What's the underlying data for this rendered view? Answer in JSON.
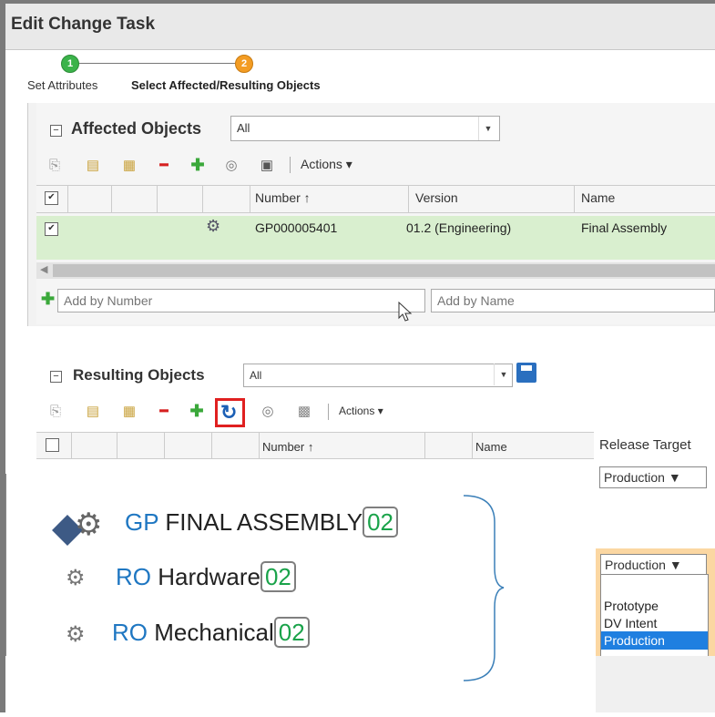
{
  "window": {
    "title": "Edit Change Task"
  },
  "wizard": {
    "steps": [
      {
        "number": "1",
        "label": "Set Attributes"
      },
      {
        "number": "2",
        "label": "Select Affected/Resulting Objects"
      }
    ]
  },
  "affected": {
    "title": "Affected Objects",
    "filter_value": "All",
    "actions_label": "Actions",
    "columns": [
      "Number ↑",
      "Version",
      "Name"
    ],
    "rows": [
      {
        "number": "GP000005401",
        "version": "01.2 (Engineering)",
        "name": "Final Assembly"
      }
    ],
    "add_by_number_placeholder": "Add by Number",
    "add_by_name_placeholder": "Add by Name"
  },
  "resulting": {
    "title": "Resulting Objects",
    "filter_value": "All",
    "actions_label": "Actions",
    "columns": [
      "Number ↑",
      "Name",
      "Release Target"
    ],
    "release_target_value": "Production ▼"
  },
  "callout": {
    "items": [
      {
        "prefix": "GP",
        "name": "FINAL ASSEMBLY",
        "rev": "02"
      },
      {
        "prefix": "RO",
        "name": "Hardware",
        "rev": "02"
      },
      {
        "prefix": "RO",
        "name": "Mechanical",
        "rev": "02"
      }
    ]
  },
  "release_dropdown": {
    "selected": "Production ▼",
    "options": [
      "Prototype",
      "DV Intent",
      "Production"
    ]
  },
  "colors": {
    "accent_blue": "#1f77c2",
    "rev_green": "#1aa34a",
    "selected_row": "#d9efcf",
    "highlight_red": "#e02020"
  }
}
